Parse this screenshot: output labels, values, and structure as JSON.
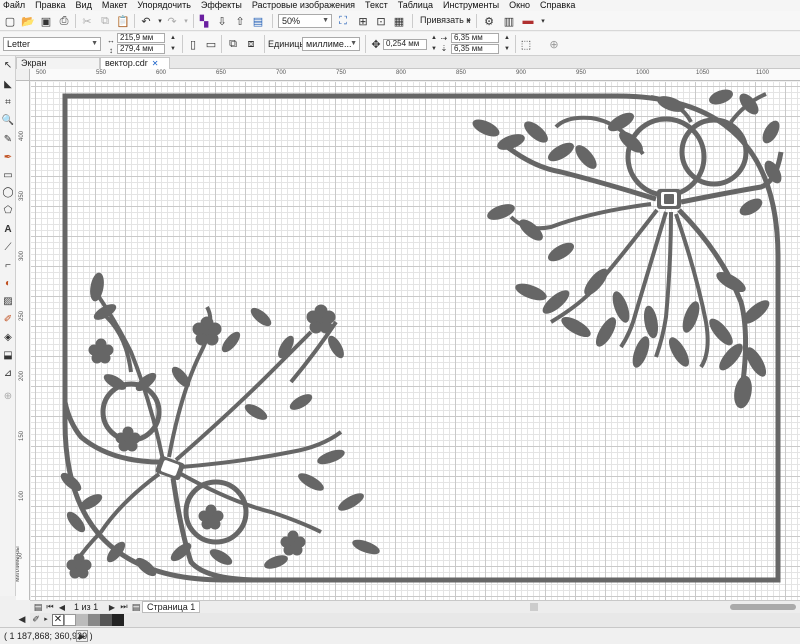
{
  "menu": [
    "Файл",
    "Правка",
    "Вид",
    "Макет",
    "Упорядочить",
    "Эффекты",
    "Растровые изображения",
    "Текст",
    "Таблица",
    "Инструменты",
    "Окно",
    "Справка"
  ],
  "toolbar": {
    "zoom": "50%",
    "snap_label": "Привязать к"
  },
  "property_bar": {
    "page_size": "Letter",
    "width": "215,9 мм",
    "height": "279,4 мм",
    "units_label": "Единицы:",
    "units_value": "миллиме...",
    "nudge": "0,254 мм",
    "dup_x": "6,35 мм",
    "dup_y": "6,35 мм"
  },
  "tabs": [
    {
      "label": "Экран приветствия"
    },
    {
      "label": "вектор.cdr"
    }
  ],
  "ruler": {
    "top_ticks": [
      "500",
      "550",
      "600",
      "650",
      "700",
      "750",
      "800",
      "850",
      "900",
      "950",
      "1000",
      "1050",
      "1100"
    ],
    "left_ticks": [
      "400",
      "350",
      "300",
      "250",
      "200",
      "150",
      "100",
      "50"
    ],
    "units_vertical": "миллиметры"
  },
  "pagebar": {
    "page_count": "1 из 1",
    "page_tab": "Страница 1"
  },
  "status": {
    "coords": "( 1 187,868; 360,929 )"
  },
  "colors": {
    "ornament": "#666666",
    "frame": "#666666",
    "grid_major": "#c9c9c9",
    "grid_minor": "#e4e4e4"
  }
}
